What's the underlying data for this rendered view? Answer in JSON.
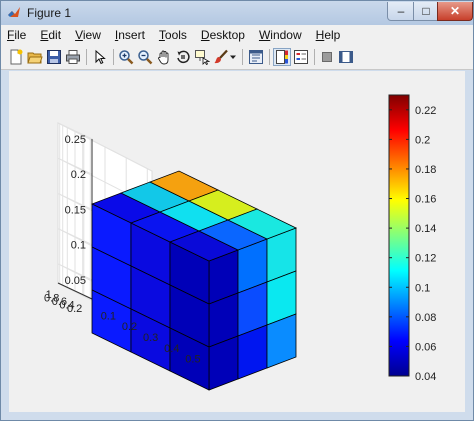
{
  "window": {
    "title": "Figure 1",
    "controls": {
      "minimize": "–",
      "maximize": "□",
      "close": "✕"
    }
  },
  "menu": [
    {
      "label": "File",
      "mnemonic": "F",
      "rest": "ile"
    },
    {
      "label": "Edit",
      "mnemonic": "E",
      "rest": "dit"
    },
    {
      "label": "View",
      "mnemonic": "V",
      "rest": "iew"
    },
    {
      "label": "Insert",
      "mnemonic": "I",
      "rest": "nsert"
    },
    {
      "label": "Tools",
      "mnemonic": "T",
      "rest": "ools"
    },
    {
      "label": "Desktop",
      "mnemonic": "D",
      "rest": "esktop"
    },
    {
      "label": "Window",
      "mnemonic": "W",
      "rest": "indow"
    },
    {
      "label": "Help",
      "mnemonic": "H",
      "rest": "elp"
    }
  ],
  "toolbar": {
    "buttons": [
      "new-figure-icon",
      "open-file-icon",
      "save-icon",
      "print-icon",
      "edit-plot-arrow-icon",
      "zoom-in-icon",
      "zoom-out-icon",
      "pan-hand-icon",
      "rotate-3d-icon",
      "data-cursor-icon",
      "brush-icon",
      "brush-dropdown-icon",
      "link-plot-icon",
      "insert-colorbar-icon",
      "insert-legend-icon",
      "hide-plot-tools-icon",
      "show-plot-tools-icon"
    ],
    "pressed": [
      "insert-colorbar-icon"
    ]
  },
  "plot": {
    "z_axis_ticks": [
      "0.05",
      "0.1",
      "0.15",
      "0.2",
      "0.25"
    ],
    "y_axis_ticks": [
      "0.2",
      "0.4",
      "0.6",
      "0.8",
      "1"
    ],
    "x_axis_ticks": [
      "0.1",
      "0.2",
      "0.3",
      "0.4",
      "0.5"
    ],
    "colorbar": {
      "ticks": [
        "0.04",
        "0.06",
        "0.08",
        "0.1",
        "0.12",
        "0.14",
        "0.16",
        "0.18",
        "0.2",
        "0.22"
      ],
      "range": [
        0.04,
        0.23
      ],
      "colormap": "jet"
    },
    "cube_face_colors": {
      "top": [
        [
          "#0a0ae8",
          "#12c8e8",
          "#f5a10f"
        ],
        [
          "#0a14f0",
          "#10e0f0",
          "#d6ee1e"
        ],
        [
          "#0a0ad8",
          "#0a66ff",
          "#1ae8e0"
        ]
      ],
      "left_front": [
        [
          "#0a1aff",
          "#0a0ae0",
          "#0000b8"
        ],
        [
          "#0a1aff",
          "#0a0ae0",
          "#0000b8"
        ],
        [
          "#0a1aff",
          "#0a0ae0",
          "#0000b8"
        ]
      ],
      "right_front": [
        [
          "#0000b8",
          "#0070ff",
          "#16e4e8"
        ],
        [
          "#0000b8",
          "#0a4cff",
          "#0ae8f0"
        ],
        [
          "#0000b8",
          "#0016f0",
          "#0a8cff"
        ]
      ]
    }
  }
}
